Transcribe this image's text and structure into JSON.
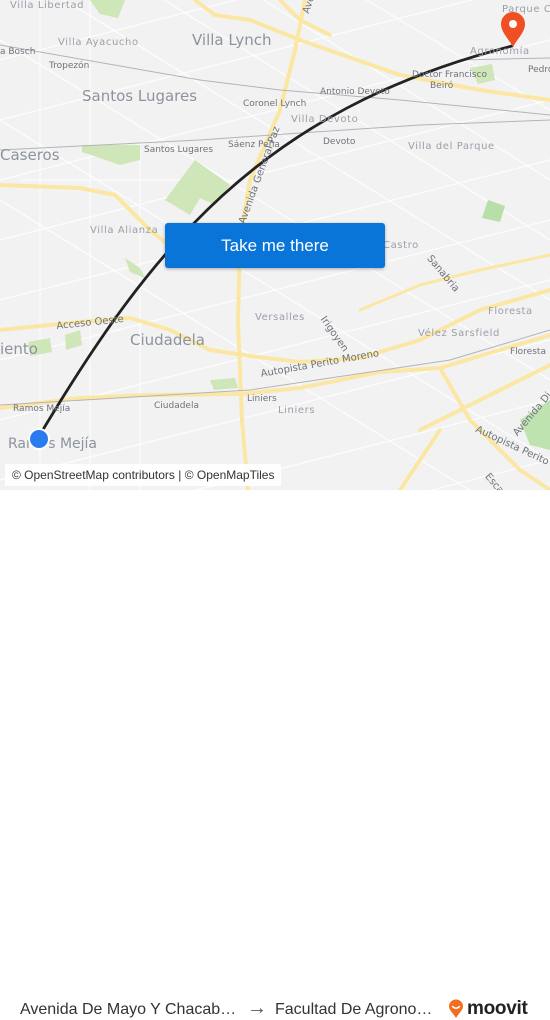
{
  "map": {
    "labels": {
      "villa_libertad": "Villa Libertad",
      "villa_ayacucho": "Villa Ayacucho",
      "villa_bosch": "a Bosch",
      "tropezon": "Tropezón",
      "santos_lugares_big": "Santos Lugares",
      "villa_lynch": "Villa Lynch",
      "avenida_top": "Avenida",
      "parque_chas": "Parque C",
      "agronomia": "Agronomía",
      "pedro": "Pedro",
      "doctor_francisco": "Doctor Francisco",
      "beiro": "Beiró",
      "antonio_devoto": "Antonio Devoto",
      "coronel_lynch": "Coronel Lynch",
      "villa_devoto": "Villa Devoto",
      "devoto": "Devoto",
      "caseros": "Caseros",
      "santos_lugares_station": "Santos Lugares",
      "saenz_pena": "Sáenz Peña",
      "general_paz": "Avenida General Paz",
      "villa_del_parque": "Villa del Parque",
      "villa_alianza": "Villa Alianza",
      "castro": "Castro",
      "sanabria": "Sanabria",
      "acceso_oeste": "Acceso Oeste",
      "versalles": "Versalles",
      "trigoyen": "Irigoyen",
      "floresta_big": "Floresta",
      "velez_sarsfield": "Vélez Sarsfield",
      "floresta_station": "Floresta",
      "sarmiento": "iento",
      "ciudadela_big": "Ciudadela",
      "autopista_perito_moreno": "Autopista Perito Moreno",
      "ramos_mejia_station": "Ramos Mejía",
      "ciudadela_station": "Ciudadela",
      "liniers_station": "Liniers",
      "liniers_big": "Liniers",
      "ramos_mejia_big": "Ramos Mejía",
      "avenida_dir": "Avenida Di",
      "autopista_perito_2": "Autopista Perito",
      "escalada": "Esca"
    },
    "route": {
      "color": "#222222"
    },
    "origin_marker": {
      "color": "#2a7bef"
    },
    "destination_marker": {
      "color": "#f04e23"
    },
    "attribution": "© OpenStreetMap contributors | © OpenMapTiles"
  },
  "cta": {
    "label": "Take me there",
    "color": "#0a75d8"
  },
  "footer": {
    "from": "Avenida De Mayo Y Chacabuco",
    "arrow": "→",
    "to": "Facultad De Agronomía",
    "brand": "moovit",
    "brand_color": "#f26f21"
  }
}
